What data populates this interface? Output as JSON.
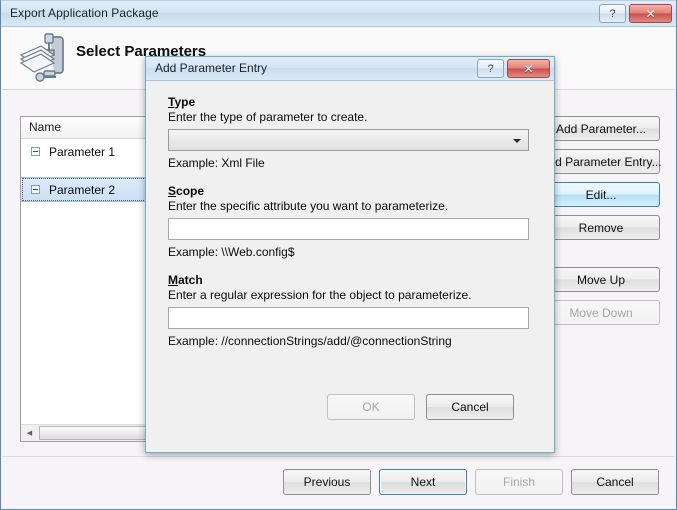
{
  "main_window": {
    "title": "Export Application Package",
    "titlebar_buttons": [
      {
        "name": "help",
        "glyph": "?"
      },
      {
        "name": "close",
        "glyph": "✕"
      }
    ],
    "header": {
      "icon": "package-clamp-icon",
      "title": "Select Parameters"
    },
    "tree": {
      "column_header": "Name",
      "rows": [
        {
          "label": "Parameter 1",
          "selected": false,
          "expanded": true
        },
        {
          "label": "Parameter 2",
          "selected": true,
          "expanded": true
        }
      ]
    },
    "side_buttons": [
      {
        "label": "Add Parameter...",
        "state": "normal"
      },
      {
        "label": "Add Parameter Entry...",
        "state": "normal"
      },
      {
        "label": "Edit...",
        "state": "hot"
      },
      {
        "label": "Remove",
        "state": "normal"
      },
      {
        "label": "Move Up",
        "state": "normal"
      },
      {
        "label": "Move Down",
        "state": "disabled"
      }
    ],
    "footer_buttons": [
      {
        "label": "Previous",
        "state": "normal"
      },
      {
        "label": "Next",
        "state": "default"
      },
      {
        "label": "Finish",
        "state": "disabled"
      },
      {
        "label": "Cancel",
        "state": "normal"
      }
    ]
  },
  "dialog": {
    "title": "Add Parameter Entry",
    "titlebar_buttons": [
      {
        "name": "help",
        "glyph": "?"
      },
      {
        "name": "close",
        "glyph": "✕"
      }
    ],
    "fields": [
      {
        "label_accel": "T",
        "label_rest": "ype",
        "description": "Enter the type of parameter to create.",
        "control": "combobox",
        "value": "",
        "example": "Example: Xml File"
      },
      {
        "label_accel": "S",
        "label_rest": "cope",
        "description": "Enter the specific attribute you want to parameterize.",
        "control": "textbox",
        "value": "",
        "example": "Example: \\\\Web.config$"
      },
      {
        "label_accel": "M",
        "label_rest": "atch",
        "description": "Enter a regular expression for the object to parameterize.",
        "control": "textbox",
        "value": "",
        "example": "Example: //connectionStrings/add/@connectionString"
      }
    ],
    "buttons": [
      {
        "label": "OK",
        "state": "disabled"
      },
      {
        "label": "Cancel",
        "state": "normal"
      }
    ]
  },
  "colors": {
    "titlebar_blue": "#d5e4f2",
    "accent_border": "#6dadcd",
    "selection_blue": "#cde0f5",
    "close_red": "#c9514a",
    "hot_button_blue": "#b4e0f7"
  }
}
